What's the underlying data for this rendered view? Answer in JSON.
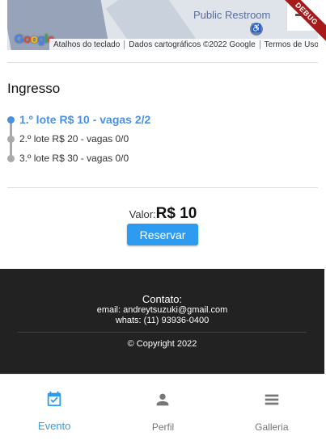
{
  "map": {
    "place_label": "Public Restroom",
    "google_letters": [
      "G",
      "o",
      "o",
      "g",
      "l",
      "e"
    ],
    "attribution": [
      "Atalhos do teclado",
      "Dados cartográficos ©2022 Google",
      "Termos de Uso"
    ]
  },
  "debug_banner": "DEBUG",
  "ingresso": {
    "title": "Ingresso",
    "lots": [
      {
        "label": "1.º lote R$ 10 - vagas 2/2",
        "active": true
      },
      {
        "label": "2.º lote R$ 20 - vagas 0/0",
        "active": false
      },
      {
        "label": "3.º lote R$ 30 - vagas 0/0",
        "active": false
      }
    ]
  },
  "price": {
    "label": "Valor:",
    "value": "R$ 10",
    "reserve_button": "Reservar"
  },
  "footer": {
    "title": "Contato:",
    "email": "email: andreytsuzuki@gmail.com",
    "phone": "whats: (11) 93936-0400",
    "copyright": "© Copyright 2022"
  },
  "nav": {
    "items": [
      {
        "label": "Evento",
        "icon": "calendar-check-icon",
        "active": true
      },
      {
        "label": "Perfil",
        "icon": "person-icon",
        "active": false
      },
      {
        "label": "Galleria",
        "icon": "list-icon",
        "active": false
      }
    ]
  },
  "colors": {
    "accent": "#2d9cf0",
    "active_step": "#4a90e2",
    "footer_bg": "#222222"
  }
}
